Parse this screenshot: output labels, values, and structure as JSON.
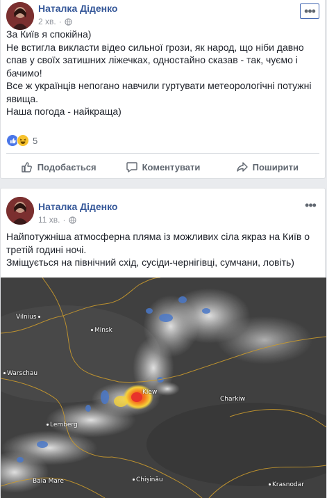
{
  "posts": [
    {
      "author": "Наталка Діденко",
      "time": "2 хв.",
      "time_sep": "·",
      "text_lines": [
        "За Київ я спокійна)",
        "Не встигла викласти відео сильної грози, як народ, що ніби давно спав у своїх затишних ліжечках, одностайно сказав - так, чуємо і бачимо!",
        "Все ж українців непогано навчили гуртувати метеорологічні потужні явища.",
        "Наша погода - найкраща)"
      ],
      "reaction_count": "5",
      "actions": {
        "like": "Подобається",
        "comment": "Коментувати",
        "share": "Поширити"
      }
    },
    {
      "author": "Наталка Діденко",
      "time": "11 хв.",
      "time_sep": "·",
      "text_lines": [
        "Найпотужніша атмосферна пляма із можливих сіла якраз на Київ о третій годині ночі.",
        "Зміщується на північний схід, сусіди-чернігівці, сумчани, ловіть)"
      ],
      "map_labels": {
        "vilnius": "Vilnius",
        "minsk": "Minsk",
        "warschau": "Warschau",
        "kiew": "Kiew",
        "charkiw": "Charkiw",
        "lemberg": "Lemberg",
        "baia_mare": "Baia Mare",
        "chisinau": "Chișinău",
        "krasnodar": "Krasnodar"
      }
    }
  ],
  "colors": {
    "link": "#365899",
    "meta": "#90949c",
    "storm_core": "#e8322b"
  }
}
